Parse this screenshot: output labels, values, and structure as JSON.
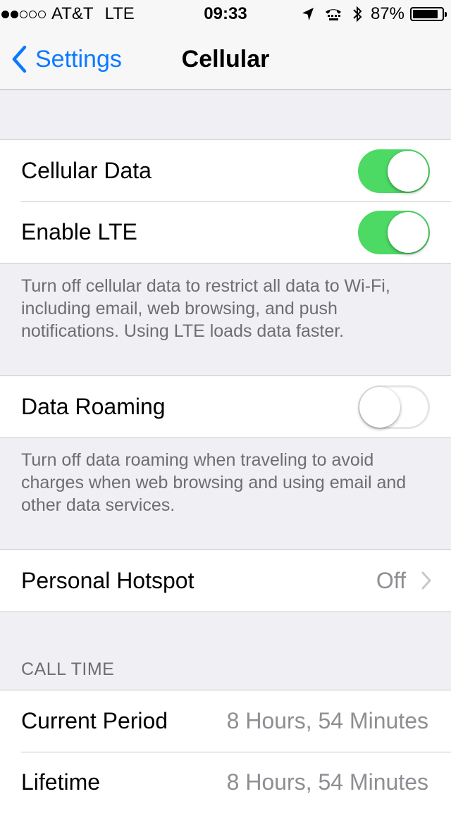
{
  "status_bar": {
    "carrier": "AT&T",
    "network": "LTE",
    "time": "09:33",
    "battery_percent": "87%",
    "battery_level": 0.87,
    "signal_bars": 2,
    "signal_total": 5,
    "icons": [
      "location-arrow-icon",
      "tty-icon",
      "bluetooth-icon",
      "battery-icon"
    ]
  },
  "nav": {
    "back_label": "Settings",
    "title": "Cellular"
  },
  "group1": {
    "cellular_data": {
      "label": "Cellular Data",
      "on": true
    },
    "enable_lte": {
      "label": "Enable LTE",
      "on": true
    },
    "footnote": "Turn off cellular data to restrict all data to Wi-Fi, including email, web browsing, and push notifications. Using LTE loads data faster."
  },
  "group2": {
    "data_roaming": {
      "label": "Data Roaming",
      "on": false
    },
    "footnote": "Turn off data roaming when traveling to avoid charges when web browsing and using email and other data services."
  },
  "group3": {
    "personal_hotspot": {
      "label": "Personal Hotspot",
      "value": "Off"
    }
  },
  "call_time": {
    "header": "CALL TIME",
    "current_period": {
      "label": "Current Period",
      "value": "8 Hours, 54 Minutes"
    },
    "lifetime": {
      "label": "Lifetime",
      "value": "8 Hours, 54 Minutes"
    }
  },
  "colors": {
    "accent": "#0a7aff",
    "switch_on": "#4cd964",
    "background": "#efeff4",
    "secondary_text": "#8e8e93"
  }
}
